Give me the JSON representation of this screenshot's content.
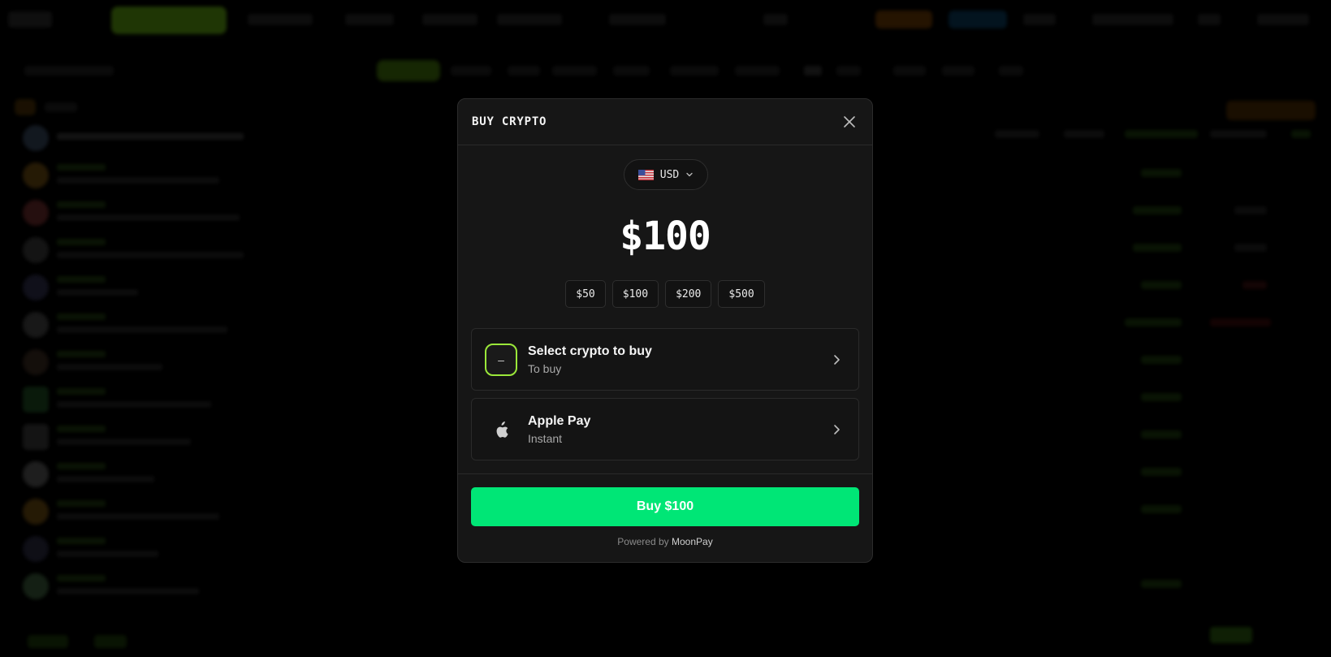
{
  "modal": {
    "title": "BUY CRYPTO",
    "close_icon": "close-icon",
    "currency": {
      "label": "USD",
      "flag_icon": "us-flag-icon",
      "chevron_icon": "chevron-down-icon"
    },
    "amount": "$100",
    "presets": [
      "$50",
      "$100",
      "$200",
      "$500"
    ],
    "crypto_option": {
      "title": "Select crypto to buy",
      "subtitle": "To buy",
      "badge": "–",
      "chevron_icon": "chevron-right-icon"
    },
    "payment_option": {
      "title": "Apple Pay",
      "subtitle": "Instant",
      "icon": "apple-icon",
      "chevron_icon": "chevron-right-icon"
    },
    "buy_button": "Buy $100",
    "powered_prefix": "Powered by",
    "powered_brand": "MoonPay"
  },
  "colors": {
    "accent_green": "#00e676",
    "badge_border": "#9be83a",
    "modal_bg": "#161616",
    "page_bg": "#000000"
  }
}
